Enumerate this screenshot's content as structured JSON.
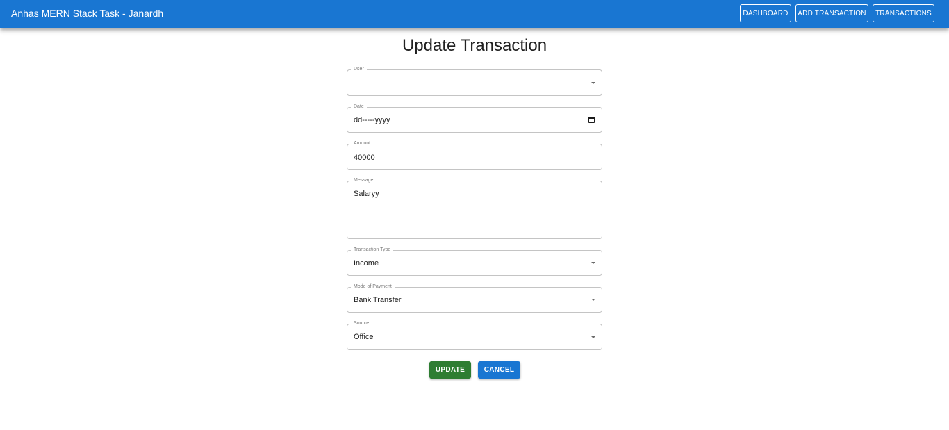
{
  "app": {
    "title": "Anhas MERN Stack Task - Janardh",
    "nav": {
      "dashboard": "DASHBOARD",
      "add_transaction": "ADD TRANSACTION",
      "transactions": "TRANSACTIONS"
    },
    "accent_color": "#1976d2"
  },
  "form": {
    "title": "Update Transaction",
    "fields": {
      "user": {
        "label": "User",
        "value": ""
      },
      "date": {
        "label": "Date",
        "value": "dd-----yyyy"
      },
      "amount": {
        "label": "Amount",
        "value": "40000"
      },
      "message": {
        "label": "Message",
        "value": "Salaryy"
      },
      "transaction_type": {
        "label": "Transaction Type",
        "value": "Income"
      },
      "mode_of_payment": {
        "label": "Mode of Payment",
        "value": "Bank Transfer"
      },
      "source": {
        "label": "Source",
        "value": "Office"
      }
    },
    "actions": {
      "update": "UPDATE",
      "cancel": "CANCEL",
      "update_color": "#2e7d32",
      "cancel_color": "#1976d2"
    }
  }
}
